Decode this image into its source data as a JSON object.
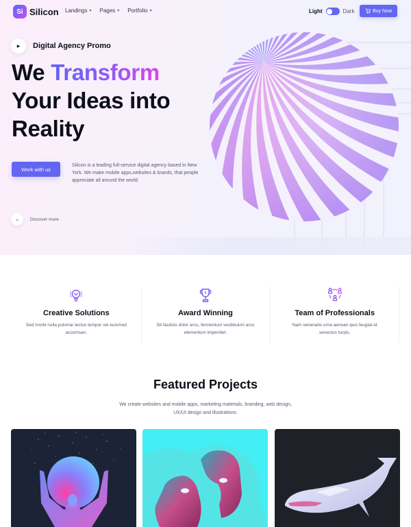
{
  "header": {
    "logo_mark": "Si",
    "logo_text": "Silicon",
    "nav": [
      {
        "label": "Landings",
        "icon": "chevron-down-icon"
      },
      {
        "label": "Pages",
        "icon": "chevron-down-icon"
      },
      {
        "label": "Portfolio",
        "icon": "chevron-down-icon"
      }
    ],
    "theme_light": "Light",
    "theme_dark": "Dark",
    "theme_mode": "light",
    "buy_icon": "cart-icon",
    "buy_label": "Buy Now"
  },
  "hero": {
    "promo_icon": "play-icon",
    "promo_label": "Digital Agency Promo",
    "title_line1_plain": "We ",
    "title_line1_accent": "Transform",
    "title_line2": "Your Ideas into",
    "title_line3": "Reality",
    "cta_label": "Work with us",
    "description": "Silicon is a leading full-service digital agency based in New York. We make mobile apps,websites & brands, that people appreciate all around the world.",
    "discover_icon": "chevron-down-icon",
    "discover_label": "Discover more"
  },
  "features": [
    {
      "icon": "lightbulb-icon",
      "title": "Creative Solutions",
      "description": "Sed morbi nulla pulvinar lectus tempor vel euismod accumsan."
    },
    {
      "icon": "trophy-icon",
      "title": "Award Winning",
      "description": "Sit facilisis dolor arcu, fermentum vestibulum arcu elementum imperdiet."
    },
    {
      "icon": "team-icon",
      "title": "Team of Professionals",
      "description": "Nam venenatis urna aenean quis feugiat et senectus turpis."
    }
  ],
  "featured_projects": {
    "title": "Featured Projects",
    "subtitle": "We create websites and mobile apps, marketing materials, branding, web design, UX/UI design and illustrations.",
    "items": [
      {
        "image": "figure-with-moon-image"
      },
      {
        "image": "fragmented-faces-image"
      },
      {
        "image": "lowpoly-whale-image"
      }
    ]
  },
  "colors": {
    "primary": "#6366f1",
    "accent_gradient_start": "#6366f1",
    "accent_gradient_end": "#d946ef",
    "heading": "#0b0f19",
    "body_text": "#565973"
  }
}
